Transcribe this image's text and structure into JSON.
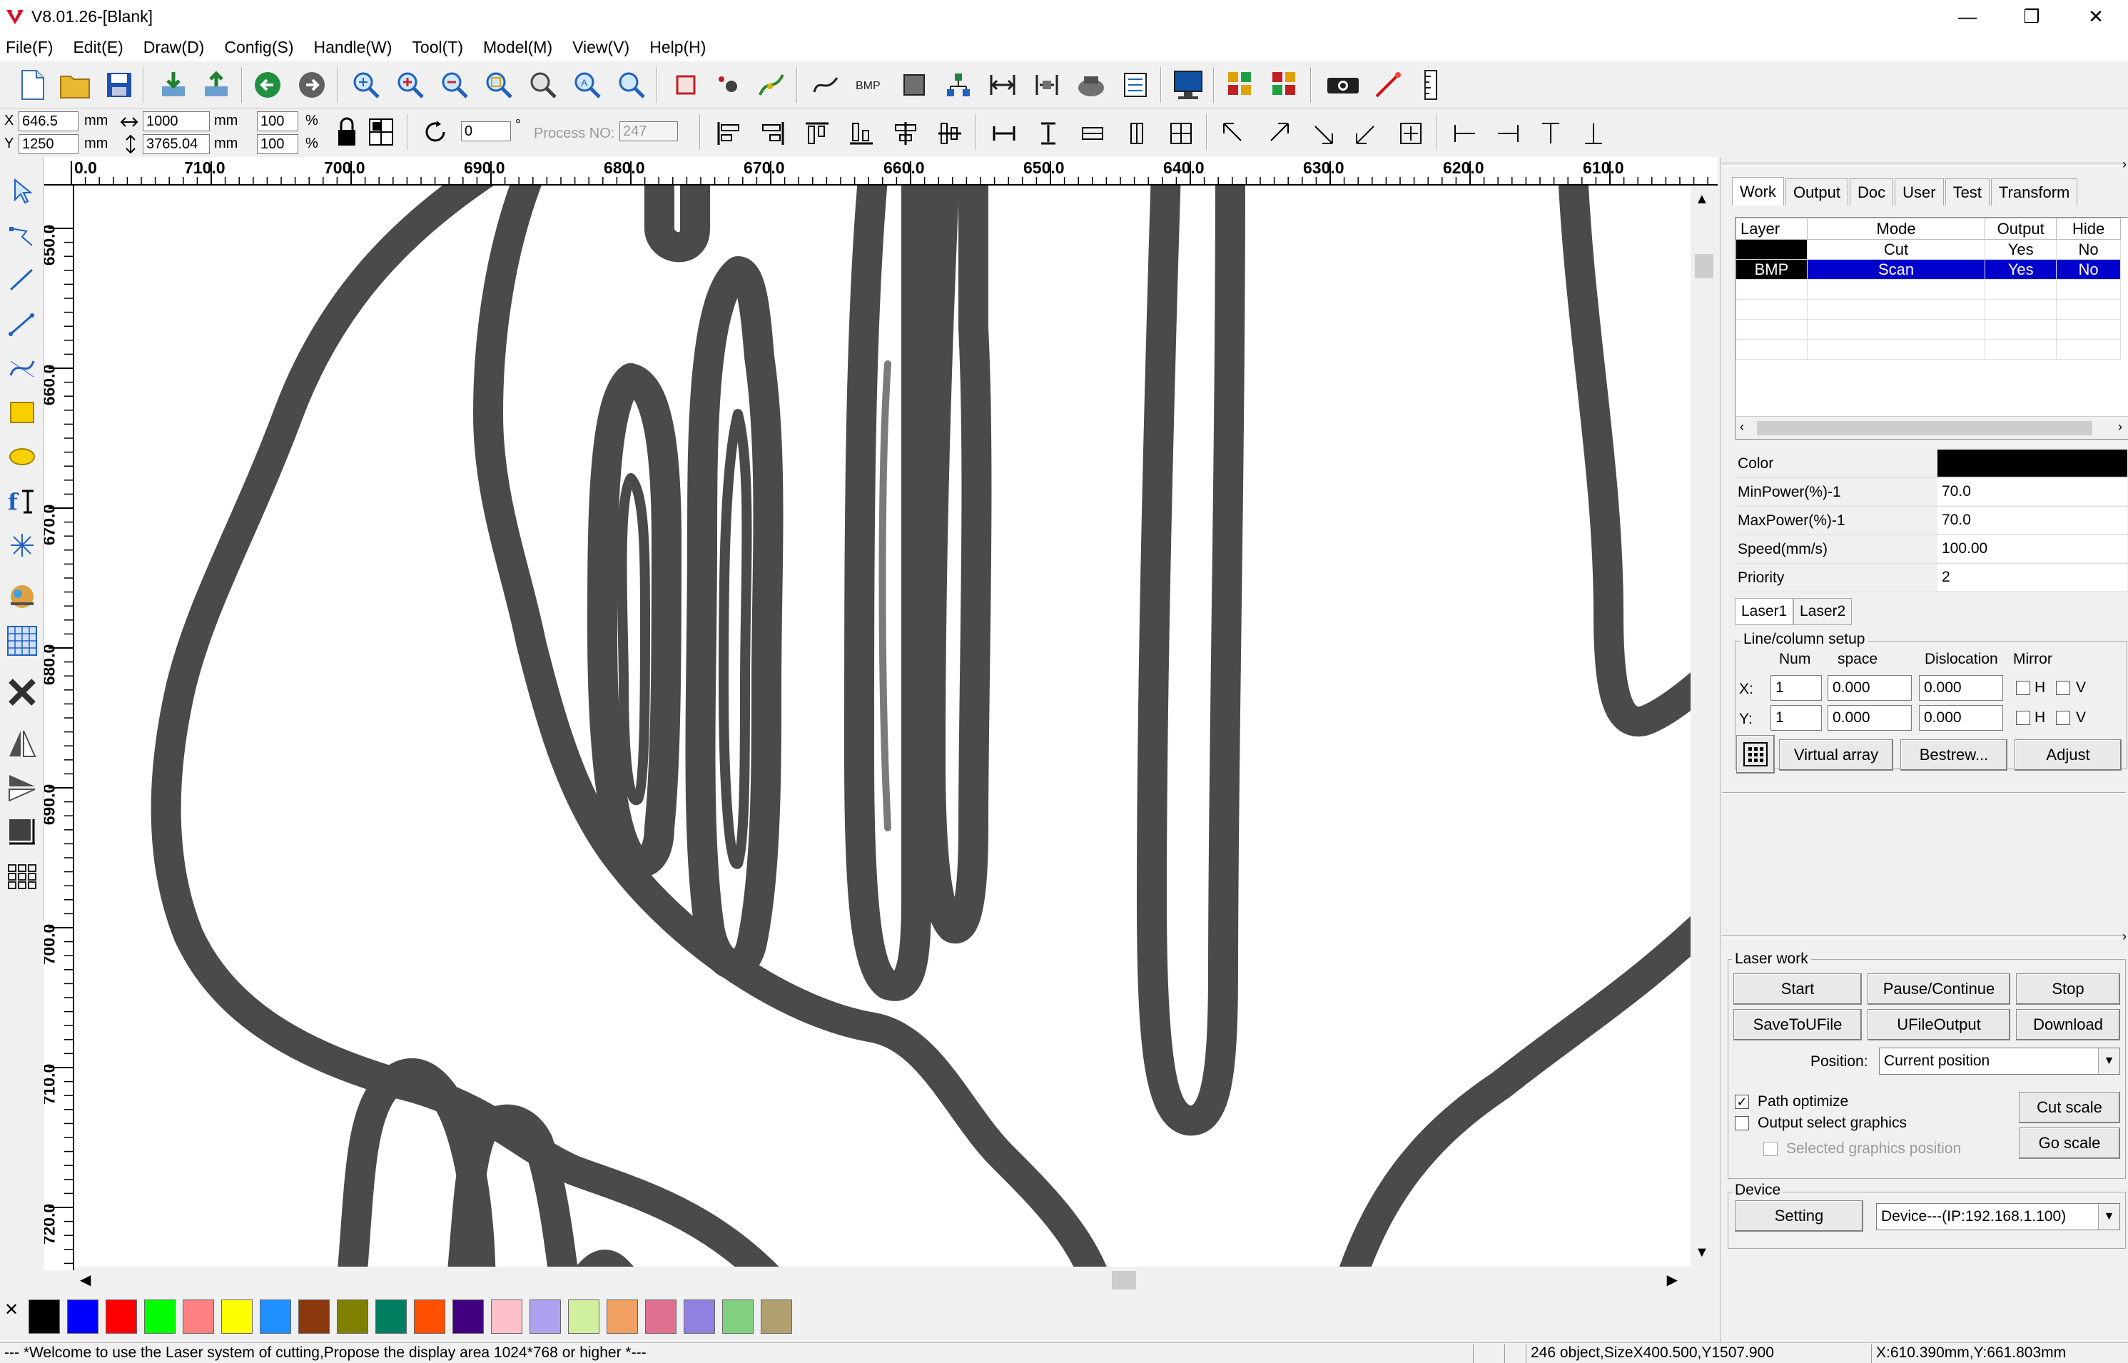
{
  "window": {
    "title": "V8.01.26-[Blank]",
    "min": "—",
    "restore": "❐",
    "close": "✕"
  },
  "menu": [
    "File(F)",
    "Edit(E)",
    "Draw(D)",
    "Config(S)",
    "Handle(W)",
    "Tool(T)",
    "Model(M)",
    "View(V)",
    "Help(H)"
  ],
  "coords": {
    "x_label": "X",
    "x_value": "646.5",
    "y_label": "Y",
    "y_value": "1250",
    "unit": "mm",
    "width_value": "1000",
    "height_value": "3765.04",
    "scale_x": "100",
    "scale_y": "100",
    "percent": "%",
    "rotate_value": "0",
    "degree": "°",
    "process_label": "Process NO:",
    "process_value": "247"
  },
  "hruler_labels": [
    "0.0",
    "710.0",
    "700.0",
    "690.0",
    "680.0",
    "670.0",
    "660.0",
    "650.0",
    "640.0",
    "630.0",
    "620.0",
    "610.0"
  ],
  "vruler_labels": [
    "650.0",
    "660.0",
    "670.0",
    "680.0",
    "690.0",
    "700.0",
    "710.0",
    "720.0"
  ],
  "tabs": [
    "Work",
    "Output",
    "Doc",
    "User",
    "Test",
    "Transform"
  ],
  "layer_table": {
    "headers": [
      "Layer",
      "Mode",
      "Output",
      "Hide"
    ],
    "rows": [
      {
        "layer": "",
        "mode": "Cut",
        "output": "Yes",
        "hide": "No",
        "color": "#000000"
      },
      {
        "layer": "BMP",
        "mode": "Scan",
        "output": "Yes",
        "hide": "No",
        "color": "#000000"
      }
    ]
  },
  "properties": [
    {
      "label": "Color",
      "value": ""
    },
    {
      "label": "MinPower(%)-1",
      "value": "70.0"
    },
    {
      "label": "MaxPower(%)-1",
      "value": "70.0"
    },
    {
      "label": "Speed(mm/s)",
      "value": "100.00"
    },
    {
      "label": "Priority",
      "value": "2"
    }
  ],
  "laser_tabs": [
    "Laser1",
    "Laser2"
  ],
  "array_setup": {
    "title": "Line/column setup",
    "headers": [
      "Num",
      "space",
      "Dislocation",
      "Mirror"
    ],
    "x_label": "X:",
    "y_label": "Y:",
    "x": {
      "num": "1",
      "space": "0.000",
      "dislocation": "0.000"
    },
    "y": {
      "num": "1",
      "space": "0.000",
      "dislocation": "0.000"
    },
    "h": "H",
    "v": "V",
    "virtual_array": "Virtual array",
    "bestrew": "Bestrew...",
    "adjust": "Adjust"
  },
  "laser_work": {
    "title": "Laser work",
    "start": "Start",
    "pause": "Pause/Continue",
    "stop": "Stop",
    "save_to_ufile": "SaveToUFile",
    "ufile_output": "UFileOutput",
    "download": "Download",
    "position_label": "Position:",
    "position_value": "Current position",
    "path_optimize": "Path optimize",
    "output_select": "Output select graphics",
    "selected_position": "Selected graphics position",
    "cut_scale": "Cut scale",
    "go_scale": "Go scale"
  },
  "device": {
    "title": "Device",
    "setting": "Setting",
    "value": "Device---(IP:192.168.1.100)"
  },
  "palette": [
    "#000000",
    "#0000ff",
    "#ff0000",
    "#00ff00",
    "#ff8080",
    "#ffff00",
    "#1e90ff",
    "#8b3a0f",
    "#808000",
    "#008060",
    "#ff5000",
    "#400080",
    "#ffc0cb",
    "#b0a0f0",
    "#d0f0a0",
    "#f0a060",
    "#e07090",
    "#9080e0",
    "#80d080",
    "#b0a070"
  ],
  "status": {
    "message": "--- *Welcome to use the Laser system of cutting,Propose the display area 1024*768 or higher *---",
    "objects": "246 object,SizeX400.500,Y1507.900",
    "position": "X:610.390mm,Y:661.803mm"
  }
}
